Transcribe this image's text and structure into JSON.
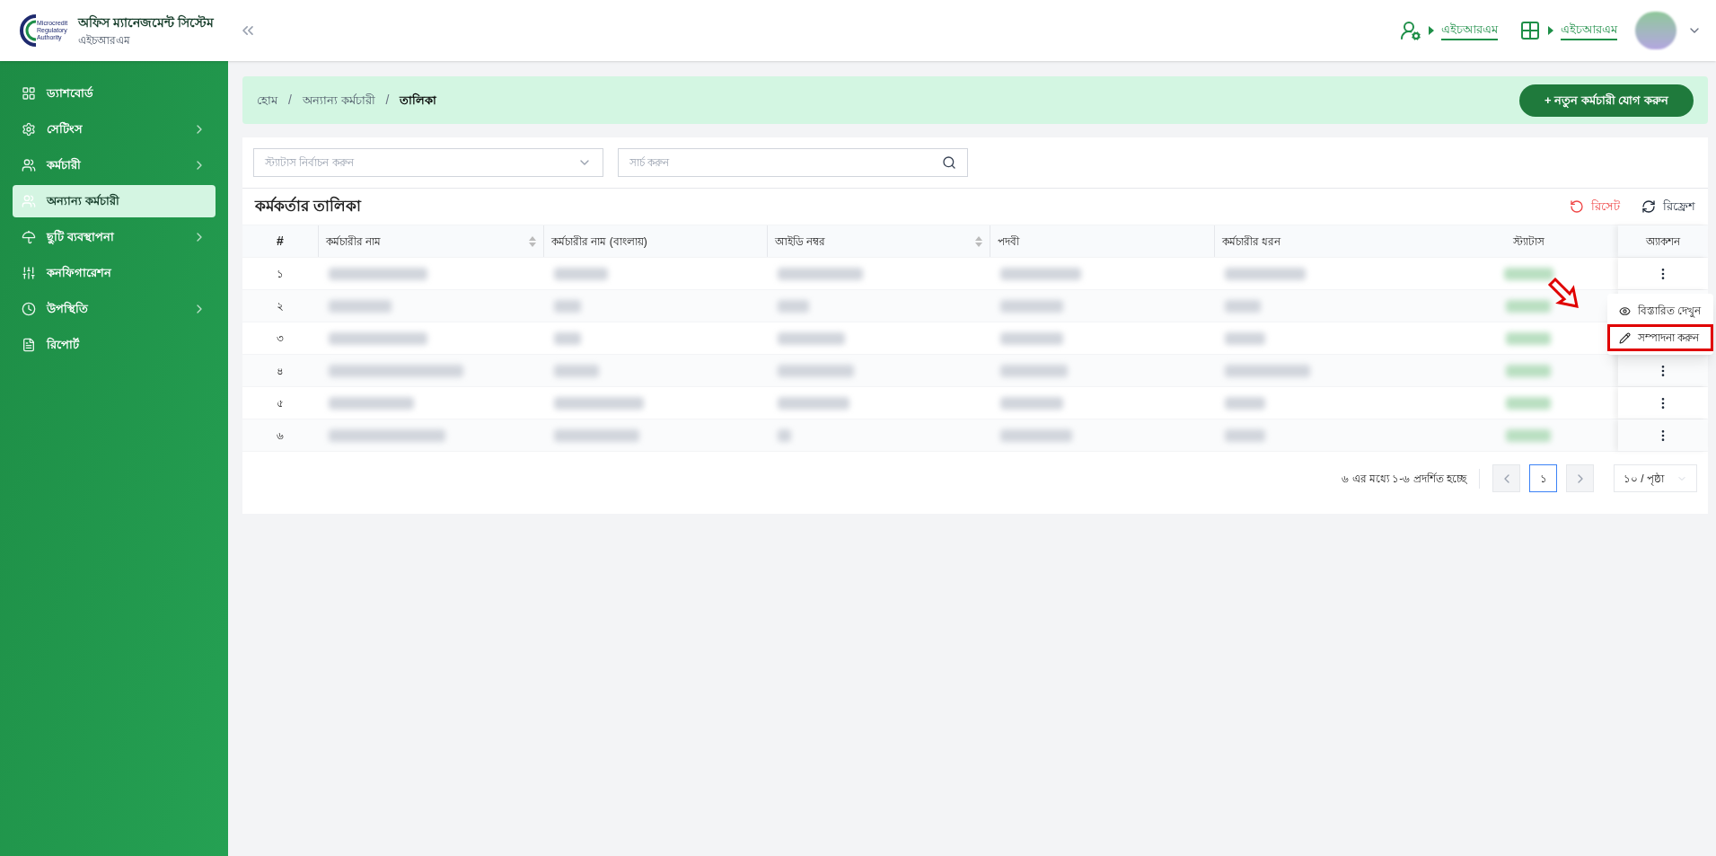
{
  "header": {
    "logo_text": [
      "Microcredit",
      "Regulatory",
      "Authority"
    ],
    "title": "অফিস ম্যানেজমেন্ট সিস্টেম",
    "subtitle": "এইচআরএম",
    "links": [
      "এইচআরএম",
      "এইচআরএম"
    ]
  },
  "sidebar": {
    "items": [
      {
        "label": "ড্যাশবোর্ড",
        "expandable": false,
        "selected": false
      },
      {
        "label": "সেটিংস",
        "expandable": true,
        "selected": false
      },
      {
        "label": "কর্মচারী",
        "expandable": true,
        "selected": false
      },
      {
        "label": "অন্যান্য কর্মচারী",
        "expandable": false,
        "selected": true
      },
      {
        "label": "ছুটি ব্যবস্থাপনা",
        "expandable": true,
        "selected": false
      },
      {
        "label": "কনফিগারেশন",
        "expandable": false,
        "selected": false
      },
      {
        "label": "উপস্থিতি",
        "expandable": true,
        "selected": false
      },
      {
        "label": "রিপোর্ট",
        "expandable": false,
        "selected": false
      }
    ]
  },
  "breadcrumb": [
    "হোম",
    "অন্যান্য কর্মচারী",
    "তালিকা"
  ],
  "breadcrumb_separators": [
    "/",
    "/"
  ],
  "add_button": "+ নতুন কর্মচারী যোগ করুন",
  "filters": {
    "status": {
      "placeholder": "স্ট্যাটাস নির্বাচন করুন"
    },
    "search": {
      "placeholder": "সার্চ করুন"
    }
  },
  "table": {
    "title": "কর্মকর্তার তালিকা",
    "reset": "রিসেট",
    "refresh": "রিফ্রেশ",
    "columns": [
      {
        "label": "#",
        "sortable": false
      },
      {
        "label": "কর্মচারীর নাম",
        "sortable": true
      },
      {
        "label": "কর্মচারীর নাম (বাংলায়)",
        "sortable": false
      },
      {
        "label": "আইডি নম্বর",
        "sortable": true
      },
      {
        "label": "পদবী",
        "sortable": false
      },
      {
        "label": "কর্মচারীর ধরন",
        "sortable": false
      },
      {
        "label": "স্ট্যাটাস",
        "sortable": false
      },
      {
        "label": "অ্যাকশন",
        "sortable": false
      }
    ],
    "rows": [
      {
        "number": "১"
      },
      {
        "number": "২"
      },
      {
        "number": "৩"
      },
      {
        "number": "৪"
      },
      {
        "number": "৫"
      },
      {
        "number": "৬"
      }
    ],
    "action_menu": [
      {
        "label": "বিস্তারিত দেখুন",
        "highlighted": false
      },
      {
        "label": "সম্পাদনা করুন",
        "highlighted": true
      }
    ]
  },
  "pagination": {
    "summary": "৬ এর মধ্যে ১-৬ প্রদর্শিত হচ্ছে",
    "pages": [
      {
        "label": "১",
        "selected": true
      }
    ],
    "prev_disabled": true,
    "next_disabled": true,
    "page_size": "১০ / পৃষ্ঠা"
  }
}
